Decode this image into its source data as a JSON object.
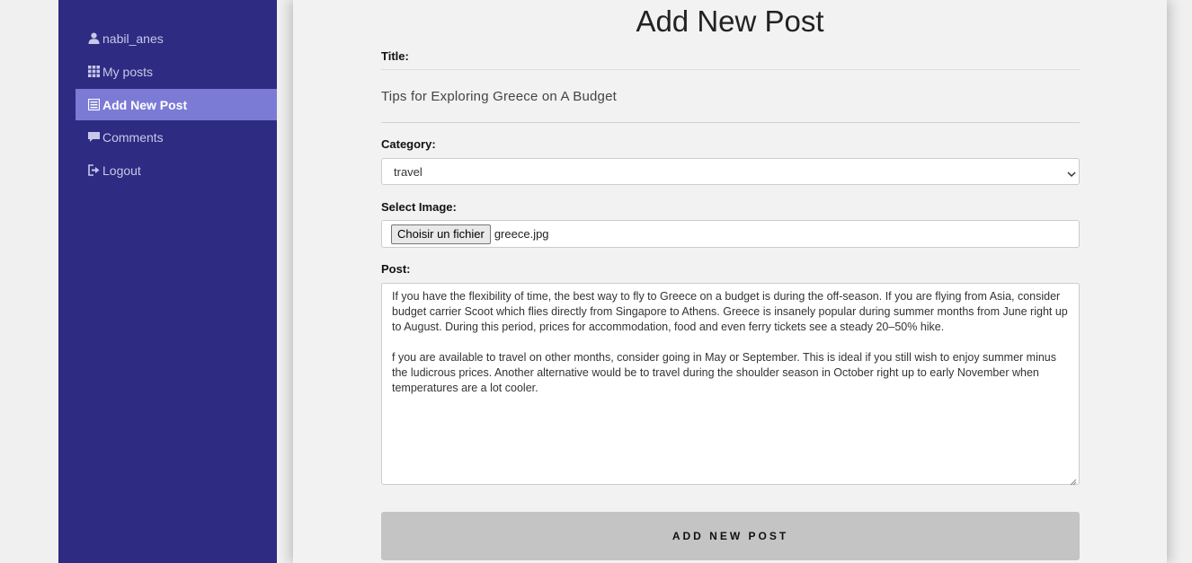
{
  "sidebar": {
    "items": [
      {
        "label": "nabil_anes",
        "icon": "user-icon",
        "active": false
      },
      {
        "label": "My posts",
        "icon": "grid-icon",
        "active": false
      },
      {
        "label": "Add New Post",
        "icon": "list-icon",
        "active": true
      },
      {
        "label": "Comments",
        "icon": "comment-icon",
        "active": false
      },
      {
        "label": "Logout",
        "icon": "logout-icon",
        "active": false
      }
    ]
  },
  "main": {
    "title": "Add New Post",
    "form": {
      "title_label": "Title:",
      "title_value": "Tips for Exploring Greece on A Budget",
      "category_label": "Category:",
      "category_value": "travel",
      "image_label": "Select Image:",
      "file_button": "Choisir un fichier",
      "file_name": "greece.jpg",
      "post_label": "Post:",
      "post_p1": "If you have the flexibility of time, the best way to fly to Greece on a budget is during the off-season. If you are flying from Asia, consider budget carrier Scoot which flies directly from Singapore to Athens. Greece is insanely popular during summer months from June right up to August. During this period, prices for accommodation, food and even ferry tickets see a steady 20–50% hike.",
      "post_p2": "f you are available to travel on other months, consider going in May or September. This is ideal if you still wish to enjoy summer minus the ludicrous prices. Another alternative would be to travel during the shoulder season in October right up to early November when temperatures are a lot cooler.",
      "submit_label": "ADD NEW POST"
    }
  },
  "colors": {
    "sidebar_bg": "#2d2b82",
    "active_item_bg": "#7b7bd6",
    "submit_bg": "#c4c4c4"
  }
}
